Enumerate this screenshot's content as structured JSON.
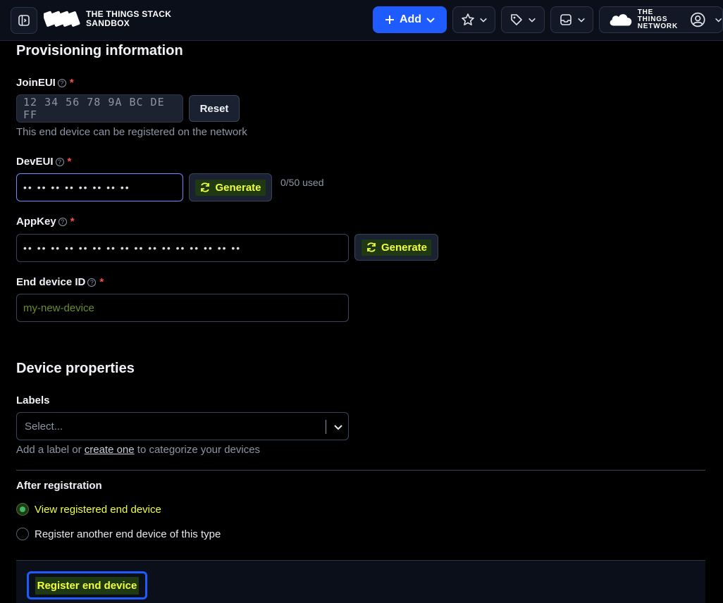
{
  "header": {
    "logo_line1": "THE THINGS STACK",
    "logo_line2": "SANDBOX",
    "add_label": "Add",
    "network_line1": "THE THINGS",
    "network_line2": "NETWORK"
  },
  "provisioning": {
    "title": "Provisioning information",
    "join_eui": {
      "label": "JoinEUI",
      "value": "12 34 56 78 9A BC DE FF",
      "reset_label": "Reset",
      "hint": "This end device can be registered on the network"
    },
    "dev_eui": {
      "label": "DevEUI",
      "value": "•• •• •• •• •• •• •• ••",
      "generate_label": "Generate",
      "usage": "0/50 used"
    },
    "app_key": {
      "label": "AppKey",
      "value": "•• •• •• •• •• •• •• •• •• •• •• •• •• •• •• ••",
      "generate_label": "Generate"
    },
    "device_id": {
      "label": "End device ID",
      "placeholder": "my-new-device"
    }
  },
  "properties": {
    "title": "Device properties",
    "labels": {
      "label": "Labels",
      "placeholder": "Select...",
      "hint_pre": "Add a label or ",
      "hint_link": "create one",
      "hint_post": " to categorize your devices"
    }
  },
  "after_registration": {
    "label": "After registration",
    "options": [
      {
        "label": "View registered end device",
        "checked": true
      },
      {
        "label": "Register another end device of this type",
        "checked": false
      }
    ]
  },
  "footer": {
    "register_label": "Register end device"
  },
  "colors": {
    "accent": "#1f5cff",
    "highlight_text": "#f1ff3a",
    "highlight_bg": "#1f3a12",
    "required": "#ff4d4f"
  }
}
